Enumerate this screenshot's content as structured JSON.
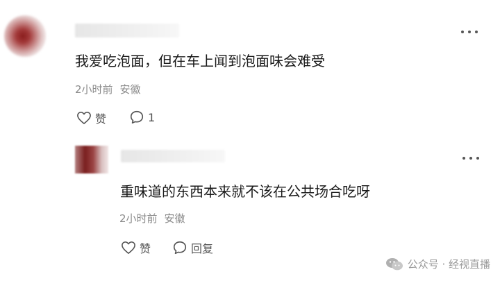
{
  "comments": [
    {
      "text": "我爱吃泡面，但在车上闻到泡面味会难受",
      "time": "2小时前",
      "location": "安徽",
      "like_label": "赞",
      "reply_count": "1"
    }
  ],
  "reply": {
    "text": "重味道的东西本来就不该在公共场合吃呀",
    "time": "2小时前",
    "location": "安徽",
    "like_label": "赞",
    "reply_label": "回复"
  },
  "watermark": {
    "text": "公众号 · 经视直播"
  },
  "icons": {
    "more": "more-dots-icon",
    "like": "heart-outline-icon",
    "comment": "speech-bubble-icon",
    "wechat": "wechat-logo-icon"
  },
  "colors": {
    "text": "#1a1a1a",
    "meta": "#8a8a8a",
    "avatar": "#8a1c1c"
  }
}
